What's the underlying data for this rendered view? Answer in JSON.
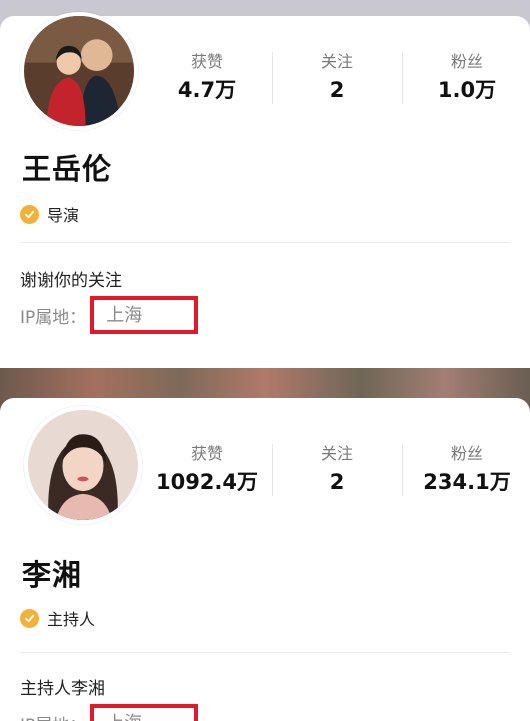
{
  "profiles": [
    {
      "stats": [
        {
          "label": "获赞",
          "value": "4.7万"
        },
        {
          "label": "关注",
          "value": "2"
        },
        {
          "label": "粉丝",
          "value": "1.0万"
        }
      ],
      "name": "王岳伦",
      "tag": "导演",
      "bio": "谢谢你的关注",
      "ip_label": "IP属地：",
      "ip_value": "上海"
    },
    {
      "stats": [
        {
          "label": "获赞",
          "value": "1092.4万"
        },
        {
          "label": "关注",
          "value": "2"
        },
        {
          "label": "粉丝",
          "value": "234.1万"
        }
      ],
      "name": "李湘",
      "tag": "主持人",
      "bio": "主持人李湘",
      "ip_label": "IP属地：",
      "ip_value": "上海"
    }
  ],
  "colors": {
    "highlight_box": "#e2182b",
    "badge": "#f2b23a"
  },
  "icons": {
    "badge": "verified-check-icon"
  }
}
